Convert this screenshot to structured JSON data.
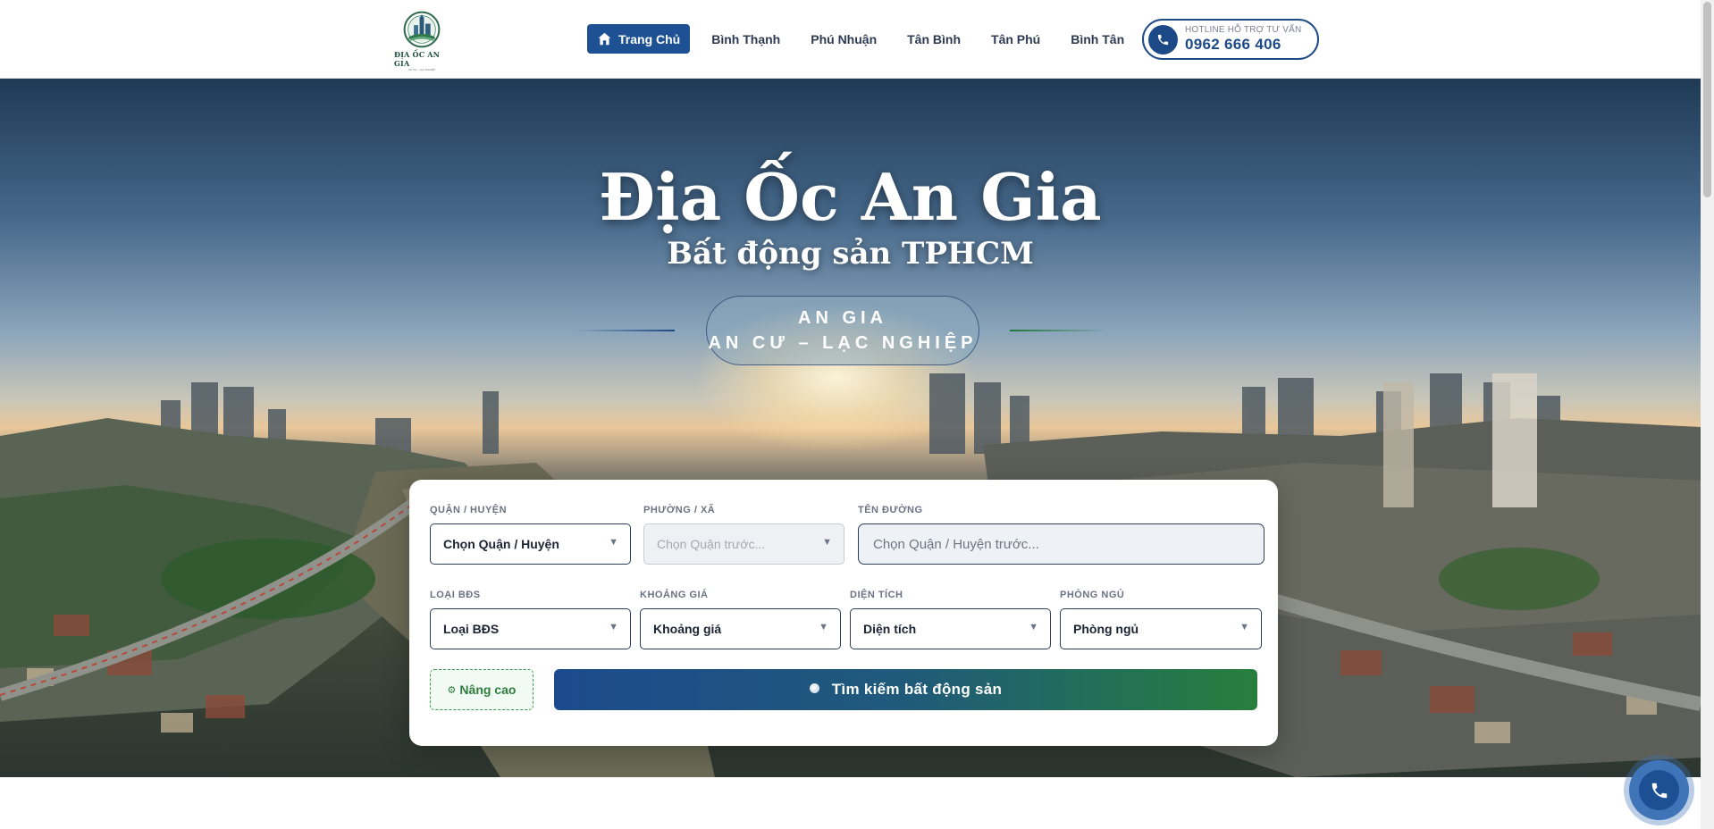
{
  "header": {
    "logo": {
      "text": "ĐỊA ỐC AN GIA",
      "subtext": "AN CƯ - LẠC NGHIỆP",
      "icon": "city-emblem-icon"
    },
    "nav": [
      {
        "label": "Trang Chủ",
        "icon": "home-icon",
        "active": true
      },
      {
        "label": "Bình Thạnh"
      },
      {
        "label": "Phú Nhuận"
      },
      {
        "label": "Tân Bình"
      },
      {
        "label": "Tân Phú"
      },
      {
        "label": "Bình Tân"
      }
    ],
    "hotline": {
      "label": "HOTLINE HỖ TRỢ TƯ VẤN",
      "number": "0962 666 406",
      "icon": "phone-icon"
    }
  },
  "hero": {
    "title": "Địa Ốc An Gia",
    "subtitle": "Bất động sản TPHCM",
    "slogan_line1": "AN GIA",
    "slogan_line2": "AN CƯ – LẠC NGHIỆP"
  },
  "search": {
    "district": {
      "label": "QUẬN / HUYỆN",
      "value": "Chọn Quận / Huyện"
    },
    "ward": {
      "label": "PHƯỜNG / XÃ",
      "value": "Chọn Quận trước..."
    },
    "street": {
      "label": "TÊN ĐƯỜNG",
      "placeholder": "Chọn Quận / Huyện trước..."
    },
    "type": {
      "label": "LOẠI BĐS",
      "value": "Loại BĐS"
    },
    "price": {
      "label": "KHOẢNG GIÁ",
      "value": "Khoảng giá"
    },
    "area": {
      "label": "DIỆN TÍCH",
      "value": "Diện tích"
    },
    "bedrooms": {
      "label": "PHÒNG NGỦ",
      "value": "Phòng ngủ"
    },
    "advanced_label": "Nâng cao",
    "submit_label": "Tìm kiếm bất động sản"
  },
  "floating": {
    "call_icon": "phone-icon"
  },
  "colors": {
    "primary": "#1d4a86",
    "accent_green": "#2e7d3e",
    "nav_active": "#1d5193"
  }
}
